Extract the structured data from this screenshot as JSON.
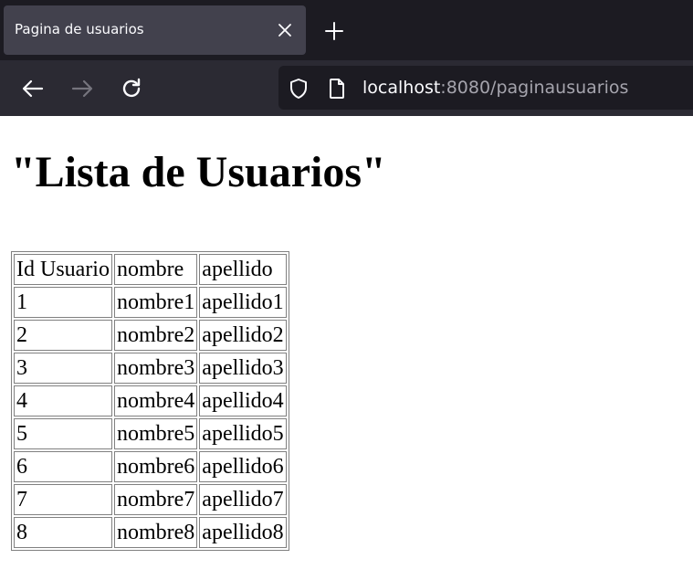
{
  "browser": {
    "tab": {
      "title": "Pagina de usuarios"
    },
    "address": {
      "host": "localhost",
      "rest": ":8080/paginausuarios"
    }
  },
  "page": {
    "heading": "\"Lista de Usuarios\"",
    "table": {
      "headers": [
        "Id Usuario",
        "nombre",
        "apellido"
      ],
      "rows": [
        [
          "1",
          "nombre1",
          "apellido1"
        ],
        [
          "2",
          "nombre2",
          "apellido2"
        ],
        [
          "3",
          "nombre3",
          "apellido3"
        ],
        [
          "4",
          "nombre4",
          "apellido4"
        ],
        [
          "5",
          "nombre5",
          "apellido5"
        ],
        [
          "6",
          "nombre6",
          "apellido6"
        ],
        [
          "7",
          "nombre7",
          "apellido7"
        ],
        [
          "8",
          "nombre8",
          "apellido8"
        ]
      ]
    }
  },
  "colors": {
    "tabbar_bg": "#1c1b22",
    "active_tab_bg": "#42414d",
    "toolbar_bg": "#2b2a33",
    "urlbar_bg": "#1c1b22",
    "table_border": "#808080"
  },
  "icons": [
    "close-icon",
    "plus-icon",
    "back-arrow-icon",
    "forward-arrow-icon",
    "reload-icon",
    "shield-icon",
    "page-icon"
  ]
}
